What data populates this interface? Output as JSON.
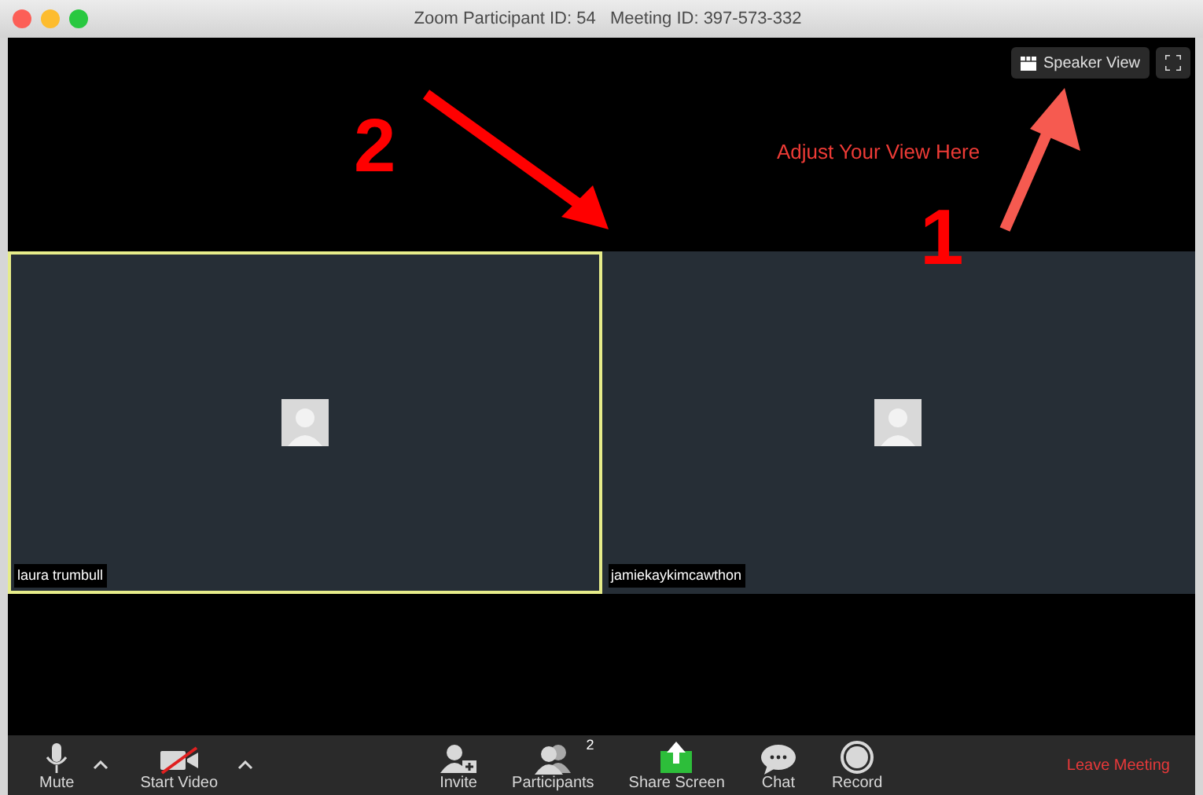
{
  "window": {
    "title": "Zoom Participant ID: 54   Meeting ID: 397-573-332"
  },
  "view_button": {
    "label": "Speaker View"
  },
  "tiles": [
    {
      "name": "laura trumbull",
      "selected": true
    },
    {
      "name": "jamiekaykimcawthon",
      "selected": false
    }
  ],
  "annotations": {
    "note": "Adjust Your View Here",
    "step_1": "1",
    "step_2": "2"
  },
  "toolbar": [
    {
      "kind": "mic",
      "label": "Mute",
      "caret": true
    },
    {
      "kind": "video",
      "label": "Start Video",
      "caret": true,
      "off": true
    },
    {
      "kind": "invite",
      "label": "Invite",
      "caret": false
    },
    {
      "kind": "participants",
      "label": "Participants",
      "count": "2",
      "caret": false
    },
    {
      "kind": "share",
      "label": "Share Screen",
      "caret": false
    },
    {
      "kind": "chat",
      "label": "Chat",
      "caret": false
    },
    {
      "kind": "record",
      "label": "Record",
      "caret": false
    }
  ],
  "leave_button": {
    "label": "Leave Meeting"
  }
}
